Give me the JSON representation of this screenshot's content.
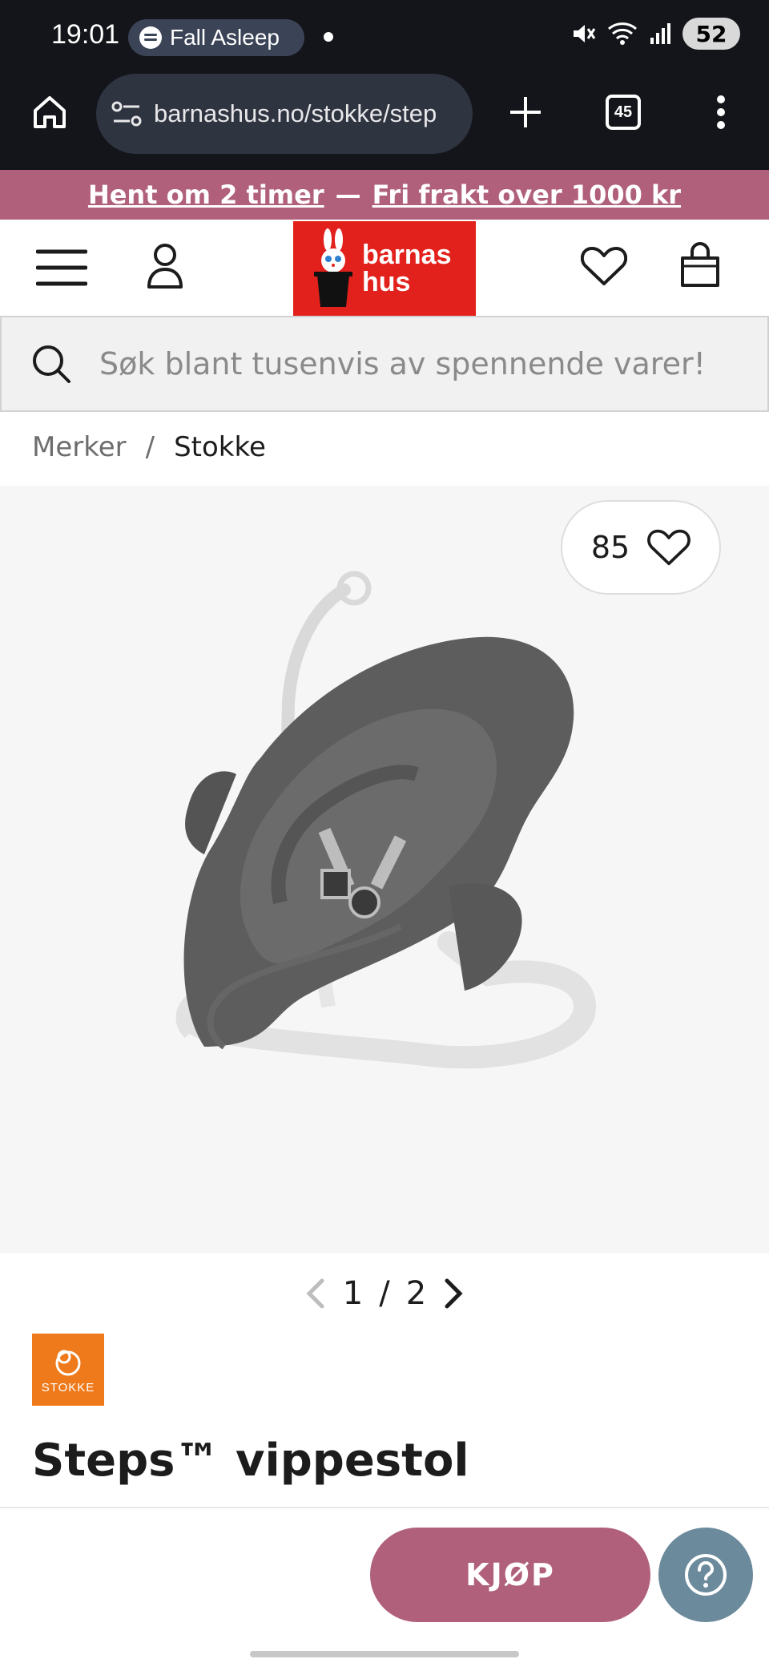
{
  "status_bar": {
    "time": "19:01",
    "media": "Fall Asleep",
    "battery": "52"
  },
  "browser": {
    "url": "barnashus.no/stokke/step",
    "tab_count": "45"
  },
  "promo": {
    "left": "Hent om 2 timer",
    "separator": "—",
    "right": "Fri frakt over 1000 kr"
  },
  "header": {
    "logo_line1": "barnas",
    "logo_line2": "hus",
    "brand_color": "#e3211c"
  },
  "search": {
    "placeholder": "Søk blant tusenvis av spennende varer!"
  },
  "breadcrumb": {
    "items": [
      "Merker",
      "Stokke"
    ],
    "separator": "/"
  },
  "product": {
    "wishlist_count": "85",
    "image_index": "1",
    "image_separator": "/",
    "image_total": "2",
    "brand_label": "STOKKE",
    "title": "Steps™ vippestol"
  },
  "actions": {
    "buy_label": "KJØP",
    "buy_color": "#b0607b",
    "help_color": "#6b8a9c"
  }
}
